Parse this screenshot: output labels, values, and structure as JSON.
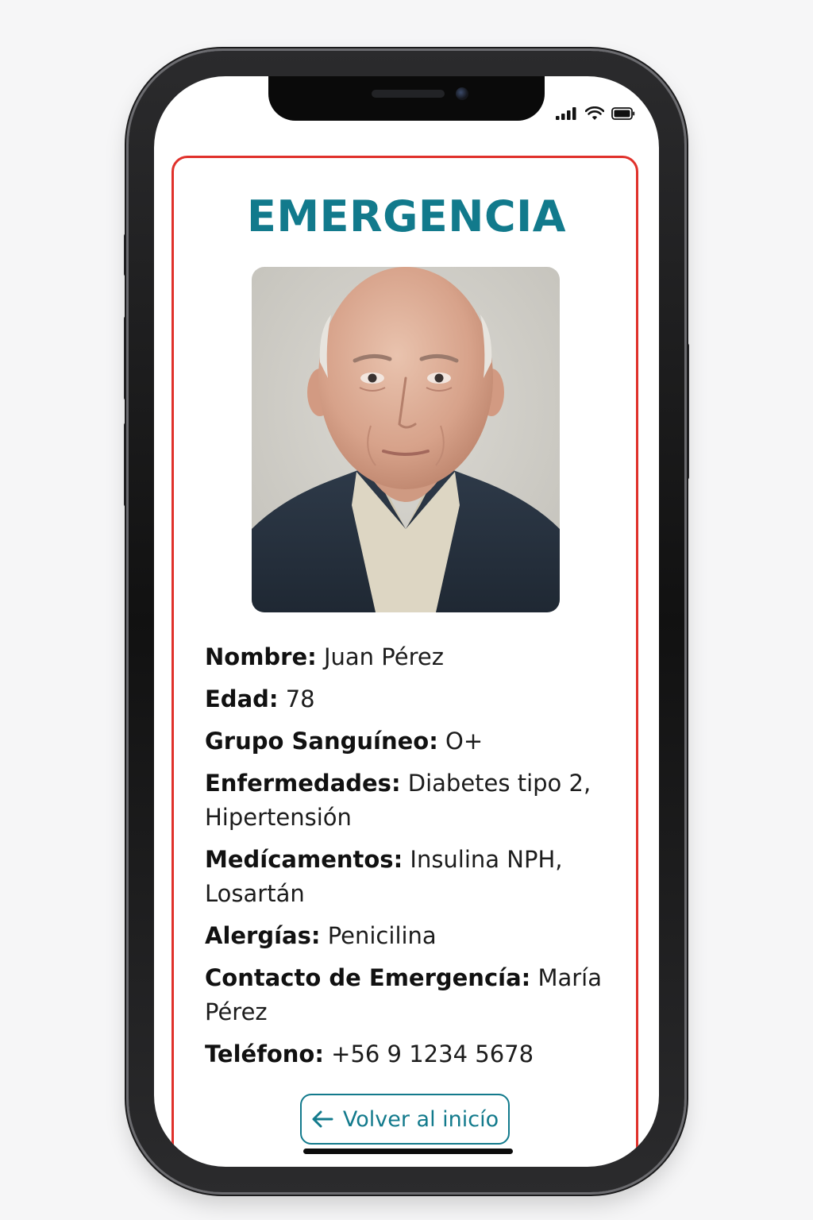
{
  "status_bar": {
    "icons": [
      "signal-icon",
      "wifi-icon",
      "battery-icon"
    ]
  },
  "card": {
    "title": "EMERGENCIA",
    "border_color": "#e0312b",
    "accent_color": "#127a8c",
    "photo": {
      "description": "portrait-photo"
    },
    "fields": [
      {
        "label": "Nombre:",
        "value": "Juan Pérez"
      },
      {
        "label": "Edad:",
        "value": "78"
      },
      {
        "label": "Grupo Sanguíneo:",
        "value": "O+"
      },
      {
        "label": "Enfermedades:",
        "value": "Diabetes tipo 2, Hipertensión"
      },
      {
        "label": "Medícamentos:",
        "value": "Insulina NPH, Losartán"
      },
      {
        "label": "Alergías:",
        "value": "Penicilina"
      },
      {
        "label": "Contacto de Emergencía:",
        "value": "María Pérez"
      },
      {
        "label": "Teléfono:",
        "value": "+56 9 1234 5678"
      }
    ],
    "back_button": {
      "label": "Volver al inicío",
      "icon": "arrow-left-icon"
    }
  }
}
